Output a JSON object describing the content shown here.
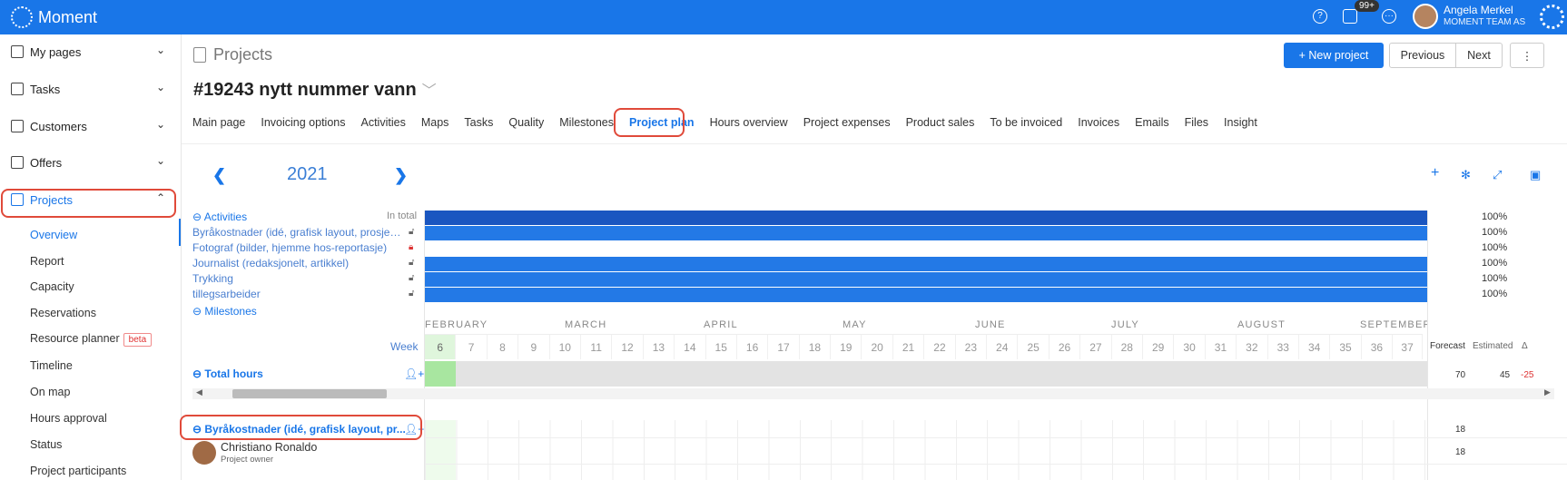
{
  "app": {
    "name": "Moment",
    "badge": "99+"
  },
  "user": {
    "name": "Angela Merkel",
    "org": "MOMENT TEAM AS"
  },
  "sidebar": {
    "items": [
      {
        "label": "My pages"
      },
      {
        "label": "Tasks"
      },
      {
        "label": "Customers"
      },
      {
        "label": "Offers"
      },
      {
        "label": "Projects"
      }
    ],
    "sub": [
      {
        "label": "Overview"
      },
      {
        "label": "Report"
      },
      {
        "label": "Capacity"
      },
      {
        "label": "Reservations"
      },
      {
        "label": "Resource planner"
      },
      {
        "label": "Timeline"
      },
      {
        "label": "On map"
      },
      {
        "label": "Hours approval"
      },
      {
        "label": "Status"
      },
      {
        "label": "Project participants"
      }
    ],
    "beta": "beta"
  },
  "header": {
    "crumb": "Projects",
    "new_label": "+ New project",
    "prev": "Previous",
    "next": "Next",
    "more": "⋮"
  },
  "project": {
    "title": "#19243 nytt nummer vann"
  },
  "tabs": [
    "Main page",
    "Invoicing options",
    "Activities",
    "Maps",
    "Tasks",
    "Quality",
    "Milestones",
    "Project plan",
    "Hours overview",
    "Project expenses",
    "Product sales",
    "To be invoiced",
    "Invoices",
    "Emails",
    "Files",
    "Insight"
  ],
  "plan": {
    "year": "2021",
    "activities_label": "Activities",
    "in_total": "In total",
    "activities": [
      {
        "name": "Byråkostnader (idé, grafisk layout, prosjektledelse)",
        "pct": "100%",
        "color": "#2379e6"
      },
      {
        "name": "Fotograf (bilder, hjemme hos-reportasje)",
        "pct": "100%",
        "color": "#ffffff"
      },
      {
        "name": "Journalist (redaksjonelt, artikkel)",
        "pct": "100%",
        "color": "#2379e6"
      },
      {
        "name": "Trykking",
        "pct": "100%",
        "color": "#2379e6"
      },
      {
        "name": "tillegsarbeider",
        "pct": "100%",
        "color": "#2379e6"
      }
    ],
    "top_pct": "100%",
    "milestones_label": "Milestones",
    "months": [
      "FEBRUARY",
      "MARCH",
      "APRIL",
      "MAY",
      "JUNE",
      "JULY",
      "AUGUST",
      "SEPTEMBER"
    ],
    "week_label": "Week",
    "weeks": [
      "6",
      "7",
      "8",
      "9",
      "10",
      "11",
      "12",
      "13",
      "14",
      "15",
      "16",
      "17",
      "18",
      "19",
      "20",
      "21",
      "22",
      "23",
      "24",
      "25",
      "26",
      "27",
      "28",
      "29",
      "30",
      "31",
      "32",
      "33",
      "34",
      "35",
      "36",
      "37"
    ],
    "cols": {
      "forecast": "Forecast",
      "estimated": "Estimated",
      "delta": "Δ"
    },
    "total": {
      "label": "Total hours",
      "forecast": "70",
      "estimated": "45",
      "delta": "-25"
    },
    "row": {
      "label": "Byråkostnader (idé, grafisk layout, pr...",
      "value": "18"
    },
    "person": {
      "name": "Christiano Ronaldo",
      "role": "Project owner",
      "value": "18"
    }
  }
}
